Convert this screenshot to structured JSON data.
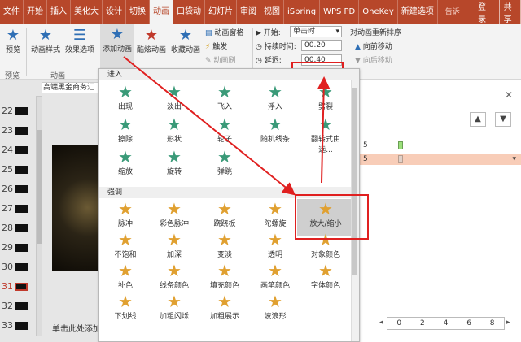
{
  "ribbon_tabs": [
    "文件",
    "开始",
    "插入",
    "美化大",
    "设计",
    "切换",
    "动画",
    "口袋动",
    "幻灯片",
    "审阅",
    "视图",
    "iSpring",
    "WPS PD",
    "OneKey",
    "新建选项"
  ],
  "active_tab": "动画",
  "tell_me": "告诉我...",
  "login": "登录",
  "share": "共享",
  "ribbon": {
    "preview": {
      "label": "预览",
      "group": "预览"
    },
    "anim_style": "动画样式",
    "effect_options": "效果选项",
    "anim_group": "动画",
    "add_anim": "添加动画",
    "brush": "酷炫动画",
    "collect": "收藏动画",
    "anim_pane": "动画窗格",
    "trigger": "触发",
    "anim_brush": "动画刷",
    "start_label": "开始:",
    "start_value": "单击时",
    "duration_label": "持续时间:",
    "duration_value": "00.20",
    "delay_label": "延迟:",
    "delay_value": "00.40",
    "reorder": "对动画重新排序",
    "move_earlier": "向前移动",
    "move_later": "向后移动"
  },
  "doc_tab": "高端黑金商务汇",
  "slides": [
    {
      "num": "22"
    },
    {
      "num": "23"
    },
    {
      "num": "24"
    },
    {
      "num": "25"
    },
    {
      "num": "26"
    },
    {
      "num": "27"
    },
    {
      "num": "28"
    },
    {
      "num": "29"
    },
    {
      "num": "30"
    },
    {
      "num": "31"
    },
    {
      "num": "32"
    },
    {
      "num": "33"
    }
  ],
  "active_slide": "31",
  "notes": "单击此处添加",
  "right_pane": {
    "row1": "5",
    "row2": "5",
    "timeline": [
      "0",
      "2",
      "4",
      "6",
      "8"
    ]
  },
  "gallery": {
    "section_enter": "进入",
    "section_emphasis": "强调",
    "enter": [
      "出现",
      "淡出",
      "飞入",
      "浮入",
      "劈裂",
      "擦除",
      "形状",
      "轮子",
      "随机线条",
      "翻转式由远...",
      "缩放",
      "旋转",
      "弹跳"
    ],
    "emphasis": [
      "脉冲",
      "彩色脉冲",
      "跷跷板",
      "陀螺旋",
      "放大/缩小",
      "不饱和",
      "加深",
      "变淡",
      "透明",
      "对象颜色",
      "补色",
      "线条颜色",
      "填充颜色",
      "画笔颜色",
      "字体颜色",
      "下划线",
      "加粗闪烁",
      "加粗展示",
      "波浪形"
    ]
  },
  "colors": {
    "accent": "#b7472a",
    "highlight": "#e02020",
    "enter_star": "#3a9a78",
    "emph_star": "#e0a030"
  }
}
